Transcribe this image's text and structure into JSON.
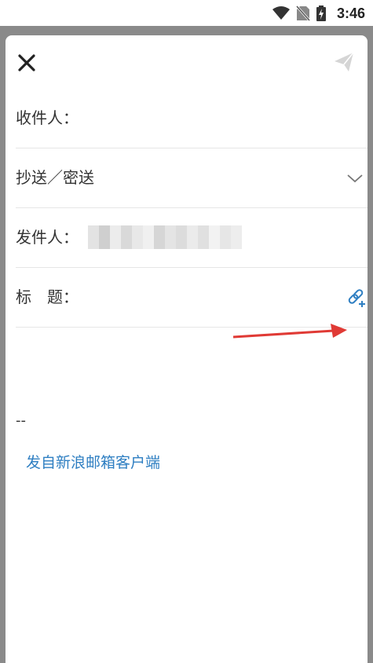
{
  "status_bar": {
    "time": "3:46",
    "icons": [
      "wifi-icon",
      "no-sim-icon",
      "battery-charging-icon"
    ]
  },
  "toolbar": {
    "close_icon": "close-icon",
    "send_icon": "send-icon"
  },
  "fields": {
    "to_label": "收件人：",
    "cc_bcc_label": "抄送／密送",
    "from_label": "发件人：",
    "subject_label": "标　题："
  },
  "body": {
    "dash": "--",
    "signature": "发自新浪邮箱客户端"
  },
  "colors": {
    "accent": "#2f7fc2",
    "annotation_arrow": "#e03a35",
    "overlay": "#8a8a8a"
  }
}
